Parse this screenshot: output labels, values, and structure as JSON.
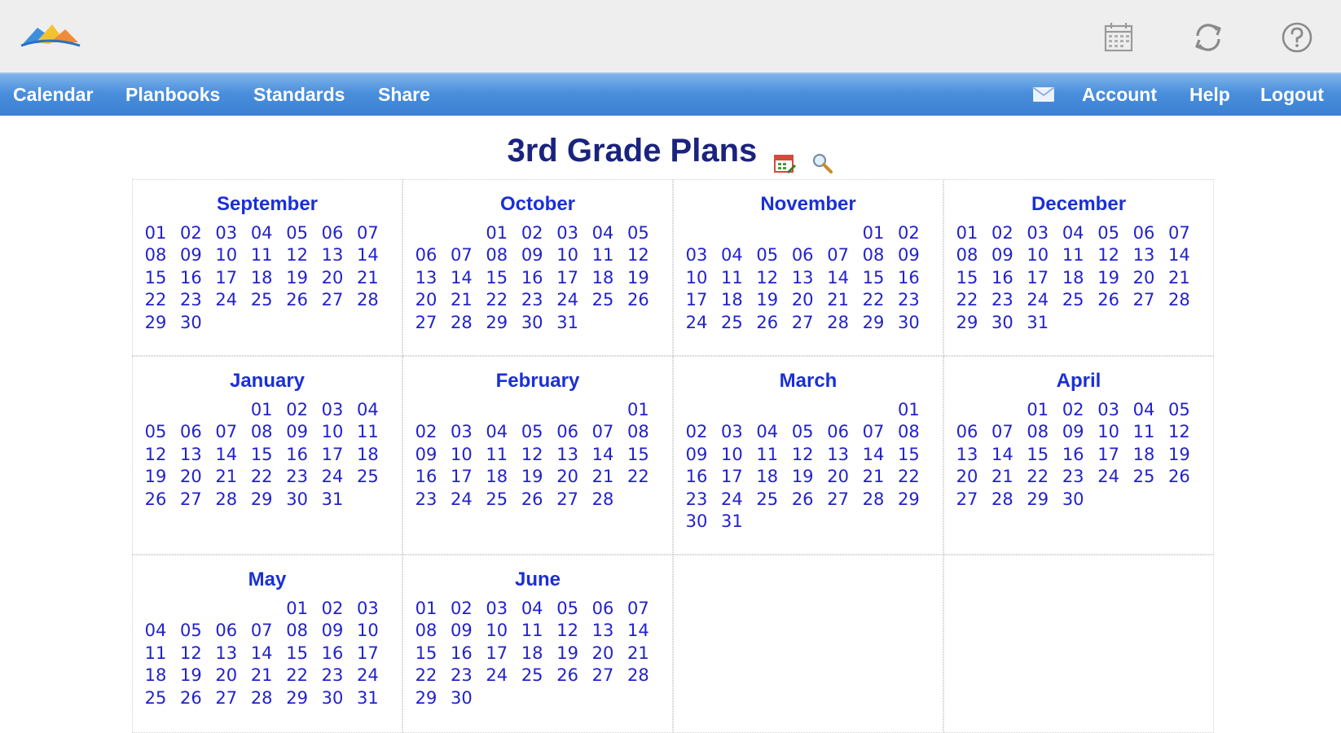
{
  "header": {
    "logo_icon": "open-book-logo-icon",
    "icons": [
      {
        "name": "calendar-icon"
      },
      {
        "name": "refresh-icon"
      },
      {
        "name": "help-circle-icon"
      }
    ]
  },
  "nav": {
    "left": [
      "Calendar",
      "Planbooks",
      "Standards",
      "Share"
    ],
    "mail_icon": "envelope-icon",
    "right": [
      "Account",
      "Help",
      "Logout"
    ]
  },
  "page": {
    "title": "3rd Grade Plans",
    "title_icons": [
      "calendar-edit-icon",
      "magnifier-icon"
    ]
  },
  "colors": {
    "nav_blue": "#4a8fdc",
    "title": "#1a237e",
    "month": "#1a2fd8",
    "day": "#2222cc"
  },
  "months": [
    {
      "name": "September",
      "offset": 0,
      "days": 30
    },
    {
      "name": "October",
      "offset": 2,
      "days": 31
    },
    {
      "name": "November",
      "offset": 5,
      "days": 30
    },
    {
      "name": "December",
      "offset": 0,
      "days": 31
    },
    {
      "name": "January",
      "offset": 3,
      "days": 31
    },
    {
      "name": "February",
      "offset": 6,
      "days": 28
    },
    {
      "name": "March",
      "offset": 6,
      "days": 31
    },
    {
      "name": "April",
      "offset": 2,
      "days": 30
    },
    {
      "name": "May",
      "offset": 4,
      "days": 31
    },
    {
      "name": "June",
      "offset": 0,
      "days": 30
    }
  ]
}
